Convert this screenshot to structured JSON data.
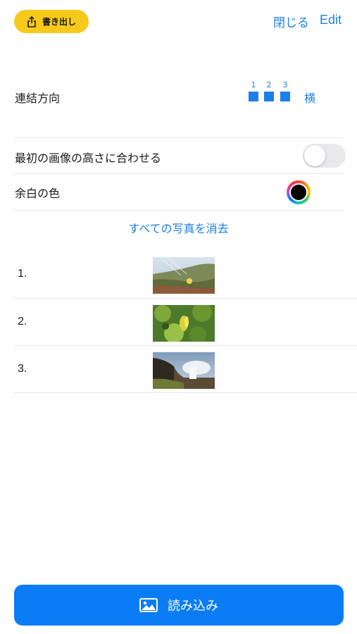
{
  "header": {
    "export_label": "書き出し",
    "export_icon": "share-icon",
    "close_label": "閉じる",
    "edit_label": "Edit"
  },
  "settings": {
    "direction": {
      "label": "連結方向",
      "numbers": [
        "1",
        "2",
        "3"
      ],
      "value": "横"
    },
    "match_height": {
      "label": "最初の画像の高さに合わせる",
      "enabled": false
    },
    "margin_color": {
      "label": "余白の色",
      "color": "#000000"
    },
    "clear_all_label": "すべての写真を消去"
  },
  "photos": [
    {
      "index": "1.",
      "description_icon": "photo-thumbnail-icon"
    },
    {
      "index": "2.",
      "description_icon": "photo-thumbnail-icon"
    },
    {
      "index": "3.",
      "description_icon": "photo-thumbnail-icon"
    }
  ],
  "footer": {
    "load_label": "読み込み",
    "load_icon": "image-icon"
  },
  "colors": {
    "accent": "#1d7fe8",
    "export_button": "#f7c91a",
    "load_button": "#0a7cf5",
    "toggle_off": "#e9e9eb"
  }
}
